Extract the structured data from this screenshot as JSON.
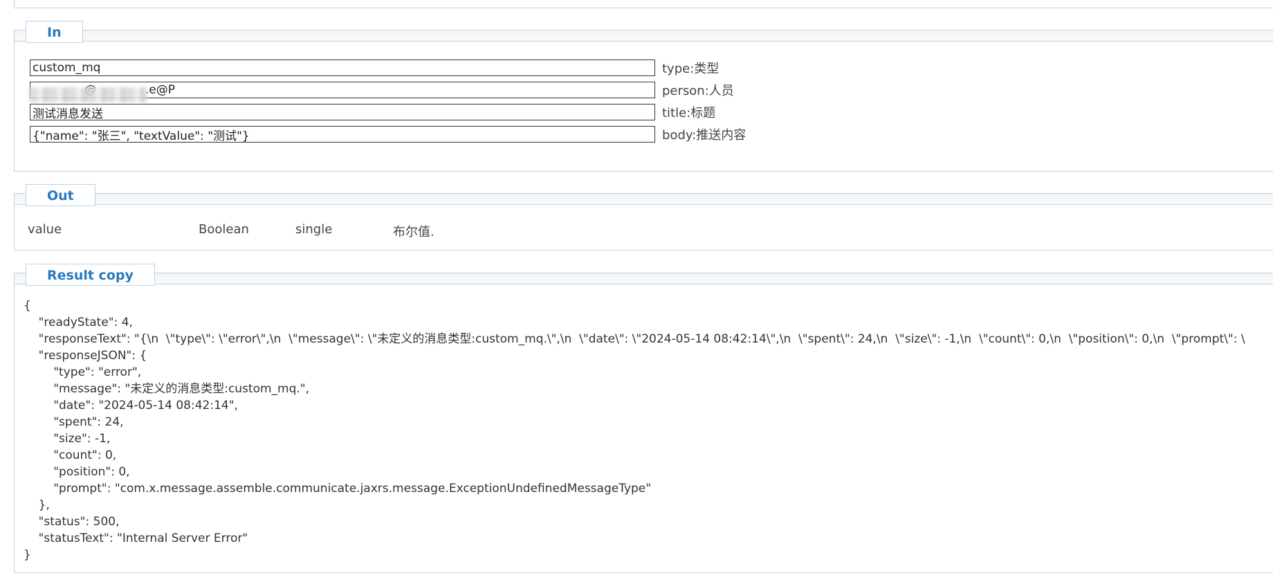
{
  "in_section": {
    "title": "In",
    "fields": [
      {
        "value": "custom_mq",
        "label": "type:类型"
      },
      {
        "value": "              @             .e@P",
        "label": "person:人员"
      },
      {
        "value": "测试消息发送",
        "label": "title:标题"
      },
      {
        "value": "{\"name\": \"张三\", \"textValue\": \"测试\"}",
        "label": "body:推送内容"
      }
    ]
  },
  "out_section": {
    "title": "Out",
    "row": {
      "name": "value",
      "type": "Boolean",
      "mode": "single",
      "description": "布尔值."
    }
  },
  "result_section": {
    "title": "Result copy",
    "json_text": "{\n    \"readyState\": 4,\n    \"responseText\": \"{\\n  \\\"type\\\": \\\"error\\\",\\n  \\\"message\\\": \\\"未定义的消息类型:custom_mq.\\\",\\n  \\\"date\\\": \\\"2024-05-14 08:42:14\\\",\\n  \\\"spent\\\": 24,\\n  \\\"size\\\": -1,\\n  \\\"count\\\": 0,\\n  \\\"position\\\": 0,\\n  \\\"prompt\\\": \\\n    \"responseJSON\": {\n        \"type\": \"error\",\n        \"message\": \"未定义的消息类型:custom_mq.\",\n        \"date\": \"2024-05-14 08:42:14\",\n        \"spent\": 24,\n        \"size\": -1,\n        \"count\": 0,\n        \"position\": 0,\n        \"prompt\": \"com.x.message.assemble.communicate.jaxrs.message.ExceptionUndefinedMessageType\"\n    },\n    \"status\": 500,\n    \"statusText\": \"Internal Server Error\"\n}"
  },
  "colors": {
    "accent": "#2a79c0",
    "border": "#b8d3ea"
  }
}
